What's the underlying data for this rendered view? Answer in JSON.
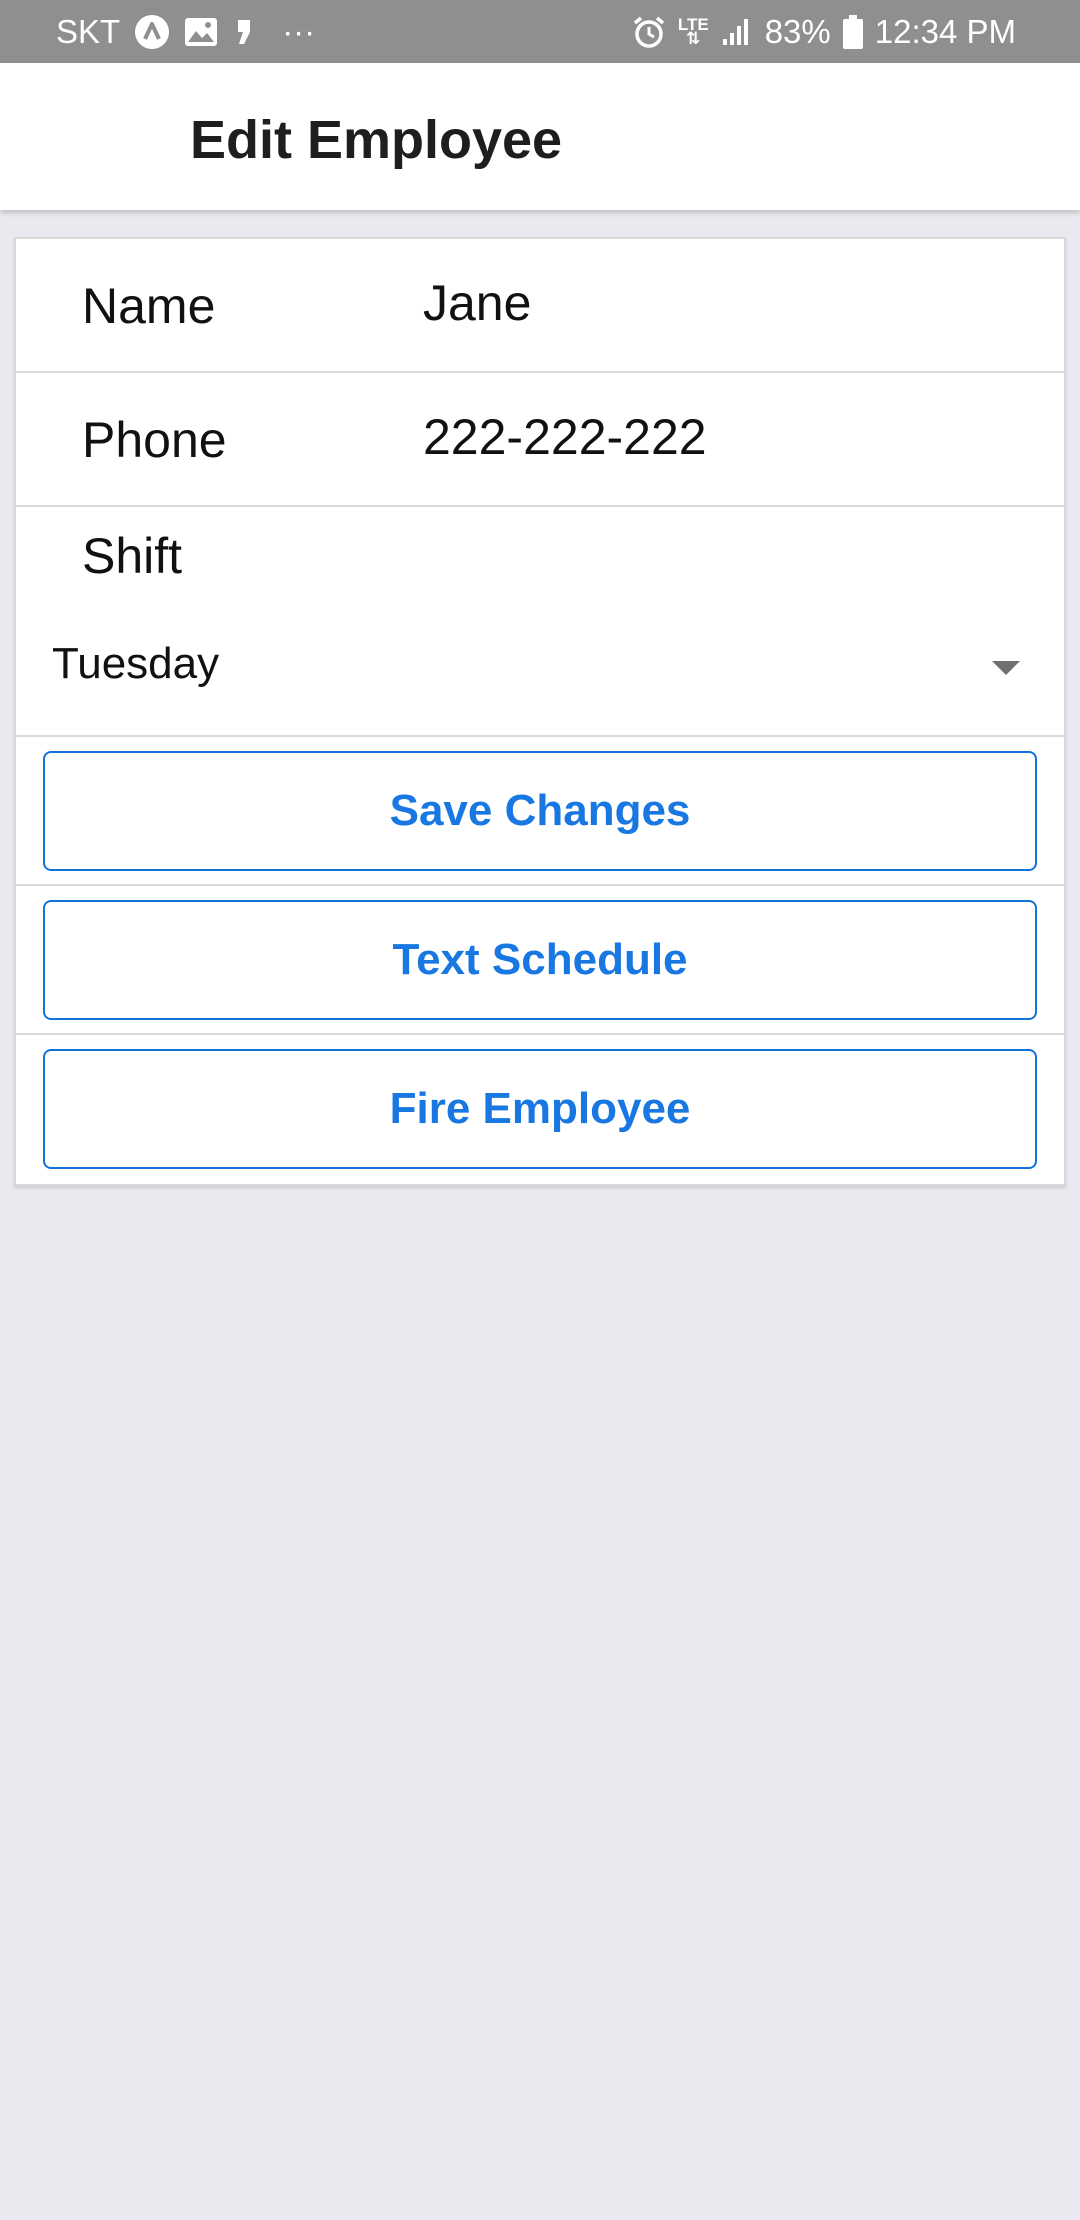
{
  "status_bar": {
    "carrier": "SKT",
    "more": "···",
    "network": "LTE",
    "battery": "83%",
    "time": "12:34 PM"
  },
  "header": {
    "title": "Edit Employee"
  },
  "form": {
    "name_label": "Name",
    "name_value": "Jane",
    "phone_label": "Phone",
    "phone_value": "222-222-222",
    "shift_label": "Shift",
    "shift_value": "Tuesday"
  },
  "buttons": {
    "save": "Save Changes",
    "text_schedule": "Text Schedule",
    "fire": "Fire Employee"
  },
  "colors": {
    "accent": "#1877e0",
    "page_bg": "#e9e9ef",
    "status_bar_bg": "#8f8f8f"
  }
}
